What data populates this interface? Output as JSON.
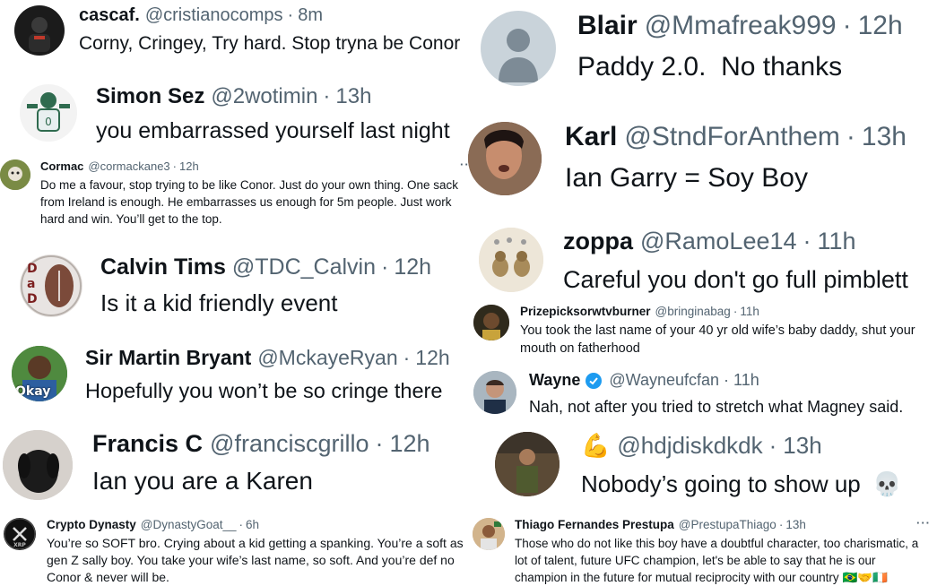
{
  "left": [
    {
      "name": "cascaf.",
      "handle": "@cristianocomps",
      "sep": "·",
      "time": "8m",
      "text": "Corny, Cringey, Try hard. Stop tryna be Conor"
    },
    {
      "name": "Simon Sez",
      "handle": "@2wotimin",
      "sep": "·",
      "time": "13h",
      "text": "you embarrassed yourself last night"
    },
    {
      "name": "Cormac",
      "handle": "@cormackane3",
      "sep": "·",
      "time": "12h",
      "text": "Do me a favour, stop trying to be like Conor. Just do your own thing. One sack from Ireland is enough. He embarrasses us enough for 5m people. Just work hard and win. You’ll get to the top."
    },
    {
      "name": "Calvin Tims",
      "handle": "@TDC_Calvin",
      "sep": "·",
      "time": "12h",
      "text": "Is it a kid friendly event",
      "avatar_letters": "DaD"
    },
    {
      "name": "Sir Martin Bryant",
      "handle": "@MckayeRyan",
      "sep": "·",
      "time": "12h",
      "text": "Hopefully you won’t be so cringe there",
      "avatar_caption": "Okay"
    },
    {
      "name": "Francis C",
      "handle": "@franciscgrillo",
      "sep": "·",
      "time": "12h",
      "text": "Ian you are a Karen"
    },
    {
      "name": "Crypto Dynasty",
      "handle": "@DynastyGoat__",
      "sep": "·",
      "time": "6h",
      "text": "You’re so SOFT bro. Crying about a kid getting a spanking. You’re a soft as gen Z sally boy. You take your wife’s last name, so soft. And you’re def no Conor & never will be.",
      "avatar_caption": "XRP"
    }
  ],
  "right": [
    {
      "name": "Blair",
      "handle": "@Mmafreak999",
      "sep": "·",
      "time": "12h",
      "text": "Paddy 2.0.  No thanks"
    },
    {
      "name": "Karl",
      "handle": "@StndForAnthem",
      "sep": "·",
      "time": "13h",
      "text": "Ian Garry = Soy Boy"
    },
    {
      "name": "zoppa",
      "handle": "@RamoLee14",
      "sep": "·",
      "time": "11h",
      "text": "Careful you don't go full pimblett"
    },
    {
      "name": "Prizepicksorwtvburner",
      "handle": "@bringinabag",
      "sep": "·",
      "time": "11h",
      "text": "You took the last name of your 40 yr old wife’s baby daddy, shut your mouth on fatherhood"
    },
    {
      "name": "Wayne",
      "handle": "@Wayneufcfan",
      "sep": "·",
      "time": "11h",
      "text": "Nah, not after you tried to stretch what Magney said.",
      "verified_icon": "verified-check"
    },
    {
      "name": "💪",
      "handle": "@hdjdiskdkdk",
      "sep": "·",
      "time": "13h",
      "text": "Nobody’s going to show up",
      "text_emoji": "💀"
    },
    {
      "name": "Thiago Fernandes Prestupa",
      "handle": "@PrestupaThiago",
      "sep": "·",
      "time": "13h",
      "text": "Those who do not like this boy have a doubtful character, too charismatic, a lot of talent, future UFC champion, let's be able to say that he is our champion in the future for mutual reciprocity with our country",
      "text_emoji": "🇧🇷🤝🇮🇪"
    }
  ],
  "more_glyph": "···",
  "colors": {
    "text": "#0f1419",
    "secondary": "#536471",
    "verified": "#1d9bf0",
    "divider": "#eff3f4"
  },
  "icons": {
    "more": "more-dots-icon",
    "verified": "verified-check-icon",
    "default_avatar": "default-profile-icon"
  }
}
